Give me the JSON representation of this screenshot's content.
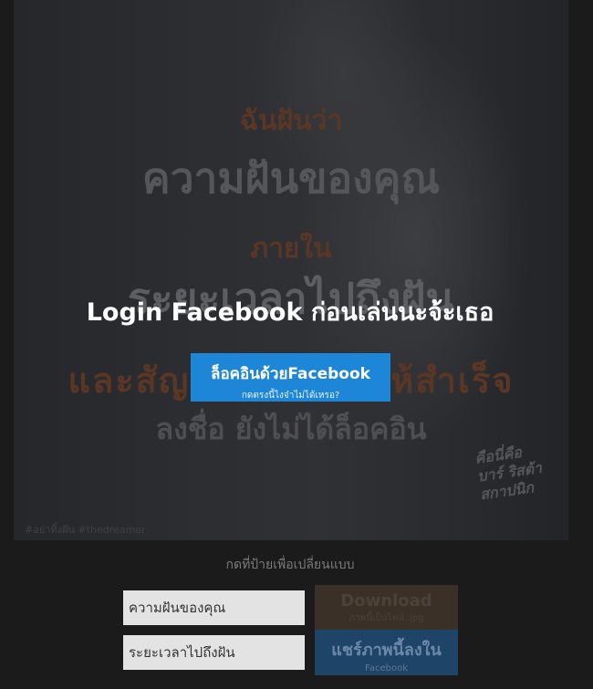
{
  "poster": {
    "lines": [
      "ฉันฝันว่า",
      "ความฝันของคุณ",
      "ภายใน",
      "ระยะเวลาไปถึงฝัน",
      "และสัญญาว่าจะทำให้สำเร็จ",
      "ลงชื่อ ยังไม่ได้ล็อคอิน"
    ],
    "hashtags": "#อย่าทิ้งฝัน #thedreamer",
    "signature": [
      "คือนี่คือ",
      "บาร์ ริสต้า",
      "สกาปนิก"
    ]
  },
  "login": {
    "title": "Login Facebook ก่อนเล่นนะจ้ะเธอ",
    "button_label": "ล็อคอินด้วยFacebook",
    "button_sub": "กดตรงนี้ไงจ๋าไม่ได้เหรอ?"
  },
  "controls": {
    "hint": "กดที่ป้ายเพื่อเปลี่ยนแบบ",
    "dream_input": "ความฝันของคุณ",
    "time_input": "ระยะเวลาไปถึงฝัน",
    "download_label": "Download",
    "download_sub": "ภาพนี้เป็นไฟล์ .jpg",
    "share_label": "แชร์ภาพนี้ลงใน",
    "share_sub": "Facebook"
  },
  "colors": {
    "background": "#1b1b1b",
    "facebook_blue": "#1e86d6",
    "poster_accent": "#5a3624"
  }
}
